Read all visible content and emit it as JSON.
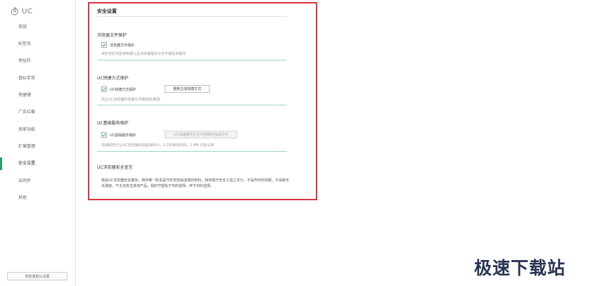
{
  "logo": {
    "text": "UC"
  },
  "sidebar": {
    "items": [
      {
        "label": "常规",
        "name": "sidebar-item-general"
      },
      {
        "label": "标签页",
        "name": "sidebar-item-tabs"
      },
      {
        "label": "地址栏",
        "name": "sidebar-item-address-bar"
      },
      {
        "label": "鼠标手势",
        "name": "sidebar-item-mouse-gestures"
      },
      {
        "label": "快捷键",
        "name": "sidebar-item-shortcuts"
      },
      {
        "label": "广告拦截",
        "name": "sidebar-item-ad-block"
      },
      {
        "label": "卖家功能",
        "name": "sidebar-item-seller"
      },
      {
        "label": "扩展管理",
        "name": "sidebar-item-extensions"
      },
      {
        "label": "安全设置",
        "name": "sidebar-item-security"
      },
      {
        "label": "云同步",
        "name": "sidebar-item-cloud-sync"
      },
      {
        "label": "其他",
        "name": "sidebar-item-other"
      }
    ],
    "active_index": 8,
    "restore_label": "恢复成默认设置"
  },
  "panel": {
    "title": "安全设置",
    "file_protect": {
      "title": "浏览器文件保护",
      "checkbox_label": "浏览器文件保护",
      "checked": true,
      "desc": "保护您的书签等数据以及浏览器程序文件不被恶意删改"
    },
    "shortcut_protect": {
      "title": "UC快捷方式保护",
      "checkbox_label": "UC快捷方式保护",
      "checked": true,
      "button_label": "重新生成快捷方式",
      "desc": "防止UC浏览器的快捷方式被劫持/删改"
    },
    "service_protect": {
      "title": "UC基础服务保护",
      "checkbox_label": "UC基础服务保护",
      "checked": true,
      "button_label": "UC加速服务正在为您随时加速文件",
      "desc": "加速服务可让UC浏览器启动提速80%，0.1秒启动时间，1 MB 内存占用"
    },
    "declaration": {
      "title": "UC浏览器安全宣言",
      "text": "我是UC浏览器安全模块，我的唯一职责是守护您自由选择的权利，我将恪守安全工具之本分，不是界你的双眼，不会耗无关弹窗，不主动攻击其他产品。我的守望始于你的选择，终于你的选择。"
    }
  },
  "watermark": {
    "text": "极速下载站"
  },
  "colors": {
    "accent": "#27a266",
    "highlight_border": "#d9343f",
    "rule_green": "#9ad9bb"
  }
}
